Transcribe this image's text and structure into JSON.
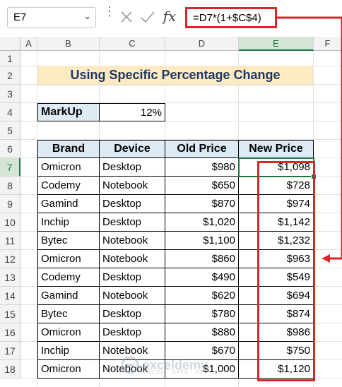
{
  "formula_bar": {
    "name_box": "E7",
    "formula": "=D7*(1+$C$4)",
    "fx_label": "fx",
    "icons": [
      "chevron-down-icon",
      "more-icon",
      "cancel-icon",
      "enter-icon",
      "fx-icon"
    ]
  },
  "columns": [
    "A",
    "B",
    "C",
    "D",
    "E",
    "F"
  ],
  "rows": [
    "1",
    "2",
    "3",
    "4",
    "5",
    "6",
    "7",
    "8",
    "9",
    "10",
    "11",
    "12",
    "13",
    "14",
    "15",
    "16",
    "17",
    "18"
  ],
  "title": "Using Specific Percentage Change",
  "markup": {
    "label": "MarkUp",
    "value": "12%"
  },
  "table": {
    "headers": [
      "Brand",
      "Device",
      "Old Price",
      "New Price"
    ],
    "rows": [
      [
        "Omicron",
        "Desktop",
        "$980",
        "$1,098"
      ],
      [
        "Codemy",
        "Notebook",
        "$650",
        "$728"
      ],
      [
        "Gamind",
        "Desktop",
        "$870",
        "$974"
      ],
      [
        "Inchip",
        "Desktop",
        "$1,020",
        "$1,142"
      ],
      [
        "Bytec",
        "Notebook",
        "$1,100",
        "$1,232"
      ],
      [
        "Omicron",
        "Notebook",
        "$860",
        "$963"
      ],
      [
        "Codemy",
        "Desktop",
        "$490",
        "$549"
      ],
      [
        "Gamind",
        "Notebook",
        "$620",
        "$694"
      ],
      [
        "Bytec",
        "Desktop",
        "$780",
        "$874"
      ],
      [
        "Omicron",
        "Desktop",
        "$880",
        "$986"
      ],
      [
        "Inchip",
        "Notebook",
        "$670",
        "$750"
      ],
      [
        "Omicron",
        "Notebook",
        "$1,000",
        "$1,120"
      ]
    ]
  },
  "colors": {
    "selection": "#217346",
    "annotation": "#d9262a",
    "header_fill": "#deebf7",
    "title_fill": "#fde9c2"
  },
  "watermark": {
    "name": "exceldemy",
    "tagline": "EXCEL · DATA · BI"
  }
}
